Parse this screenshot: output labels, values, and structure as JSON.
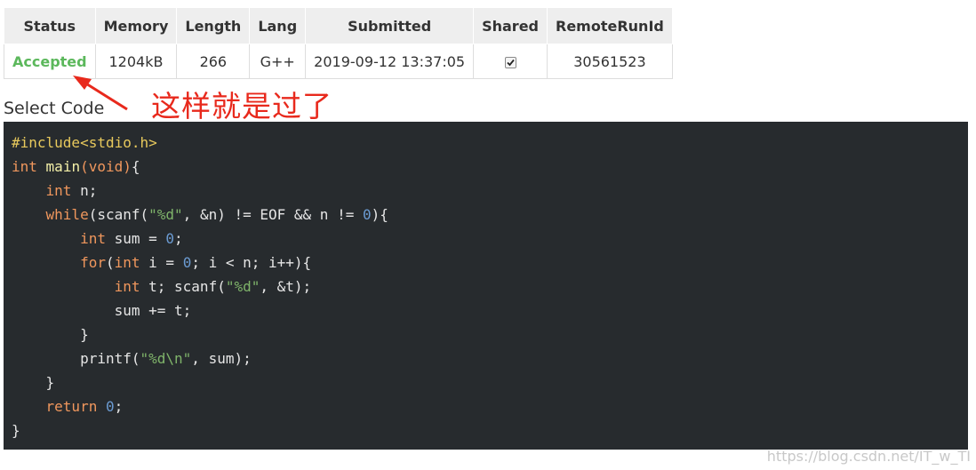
{
  "table": {
    "headers": [
      "Status",
      "Memory",
      "Length",
      "Lang",
      "Submitted",
      "Shared",
      "RemoteRunId"
    ],
    "row": {
      "status": "Accepted",
      "memory": "1204kB",
      "length": "266",
      "lang": "G++",
      "submitted": "2019-09-12 13:37:05",
      "shared": true,
      "remote_run_id": "30561523"
    }
  },
  "annotation": "这样就是过了",
  "select_code_label": "Select Code",
  "code": {
    "lines": [
      "#include<stdio.h>",
      "int main(void){",
      "    int n;",
      "    while(scanf(\"%d\", &n) != EOF && n != 0){",
      "        int sum = 0;",
      "        for(int i = 0; i < n; i++){",
      "            int t; scanf(\"%d\", &t);",
      "            sum += t;",
      "        }",
      "        printf(\"%d\\n\", sum);",
      "    }",
      "    return 0;",
      "}"
    ]
  },
  "watermark": "https://blog.csdn.net/IT_w_TI",
  "colors": {
    "accepted": "#5cb85c",
    "annotation_red": "#e8291c",
    "code_background": "#272b2e"
  }
}
